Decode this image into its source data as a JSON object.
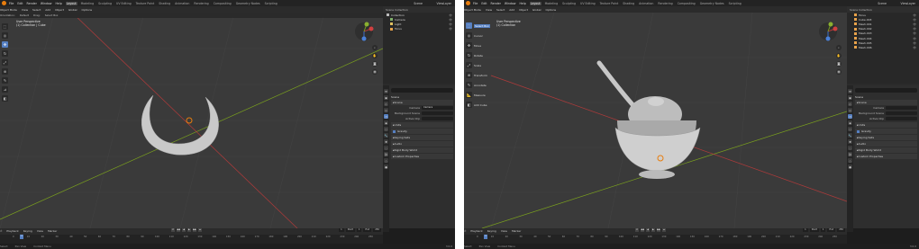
{
  "left": {
    "menu": [
      "File",
      "Edit",
      "Render",
      "Window",
      "Help"
    ],
    "workspaces": [
      "Layout",
      "Modeling",
      "Sculpting",
      "UV Editing",
      "Texture Paint",
      "Shading",
      "Animation",
      "Rendering",
      "Compositing",
      "Geometry Nodes",
      "Scripting"
    ],
    "active_workspace": "Layout",
    "scene": "Scene",
    "view_layer": "ViewLayer",
    "header": [
      "Object Mode",
      "View",
      "Select",
      "Add",
      "Object",
      "Global",
      "Options"
    ],
    "tool_settings": [
      "Orientation:",
      "Default",
      "Drag:",
      "Select Box"
    ],
    "viewport_info": {
      "line1": "User Perspective",
      "line2": "(1) Collection | Cube"
    },
    "outliner": {
      "title": "Scene Collection",
      "rows": [
        {
          "label": "Collection",
          "color": "#bbbbbb"
        },
        {
          "label": "Camera",
          "color": "#7fb06a"
        },
        {
          "label": "Light",
          "color": "#e0c060"
        },
        {
          "label": "Torus",
          "color": "#e8a24a"
        }
      ]
    },
    "props": {
      "search": "",
      "title": "Scene",
      "sections": [
        {
          "label": "Scene",
          "rows": [
            {
              "k": "Camera",
              "v": "Camera"
            },
            {
              "k": "Background Scene",
              "v": ""
            },
            {
              "k": "Active Clip",
              "v": ""
            }
          ]
        },
        {
          "label": "Units"
        },
        {
          "label": "Gravity",
          "check": true
        },
        {
          "label": "Keying Sets"
        },
        {
          "label": "Audio"
        },
        {
          "label": "Rigid Body World"
        },
        {
          "label": "Custom Properties"
        }
      ]
    },
    "timeline": {
      "items": [
        "Playback",
        "Keying",
        "View",
        "Marker"
      ],
      "current_frame": "1",
      "start_label": "Start",
      "start": "1",
      "end_label": "End",
      "end": "250",
      "ticks": [
        "0",
        "10",
        "20",
        "30",
        "40",
        "50",
        "60",
        "70",
        "80",
        "90",
        "100",
        "110",
        "120",
        "130",
        "140",
        "150",
        "160",
        "170",
        "180",
        "190",
        "200",
        "210",
        "220",
        "230",
        "240",
        "250"
      ]
    },
    "status": [
      "Select",
      "Pan View",
      "Context Menu"
    ],
    "version": "3.0.0"
  },
  "right": {
    "menu": [
      "File",
      "Edit",
      "Render",
      "Window",
      "Help"
    ],
    "workspaces": [
      "Layout",
      "Modeling",
      "Sculpting",
      "UV Editing",
      "Texture Paint",
      "Shading",
      "Animation",
      "Rendering",
      "Compositing",
      "Geometry Nodes",
      "Scripting"
    ],
    "active_workspace": "Layout",
    "scene": "Scene",
    "view_layer": "ViewLayer",
    "header": [
      "Object Mode",
      "View",
      "Select",
      "Add",
      "Object",
      "Global",
      "Options"
    ],
    "viewport_info": {
      "line1": "User Perspective",
      "line2": "(1) Collection"
    },
    "tools": [
      {
        "label": "Select Box",
        "icon": "⬚",
        "active": true
      },
      {
        "label": "Cursor",
        "icon": "◎"
      },
      {
        "label": "Move",
        "icon": "✥"
      },
      {
        "label": "Rotate",
        "icon": "↻"
      },
      {
        "label": "Scale",
        "icon": "⤢"
      },
      {
        "label": "Transform",
        "icon": "⊕"
      },
      {
        "label": "Annotate",
        "icon": "✎"
      },
      {
        "label": "Measure",
        "icon": "📐"
      },
      {
        "label": "Add Cube",
        "icon": "◧"
      }
    ],
    "outliner": {
      "title": "Scene Collection",
      "rows": [
        {
          "label": "Torus",
          "color": "#e8a24a"
        },
        {
          "label": "Cube.003",
          "color": "#e8a24a"
        },
        {
          "label": "Mesh.001",
          "color": "#e8a24a"
        },
        {
          "label": "Mesh.002",
          "color": "#e8a24a"
        },
        {
          "label": "Mesh.003",
          "color": "#e8a24a"
        },
        {
          "label": "Mesh.004",
          "color": "#e8a24a"
        },
        {
          "label": "Mesh.005",
          "color": "#e8a24a"
        },
        {
          "label": "Mesh.006",
          "color": "#e8a24a"
        }
      ]
    },
    "props": {
      "search": "",
      "title": "Scene",
      "sections": [
        {
          "label": "Scene",
          "rows": [
            {
              "k": "Camera",
              "v": ""
            },
            {
              "k": "Background Scene",
              "v": ""
            },
            {
              "k": "Active Clip",
              "v": ""
            }
          ]
        },
        {
          "label": "Units"
        },
        {
          "label": "Gravity",
          "check": true
        },
        {
          "label": "Keying Sets"
        },
        {
          "label": "Audio"
        },
        {
          "label": "Rigid Body World"
        },
        {
          "label": "Custom Properties"
        }
      ]
    },
    "timeline": {
      "items": [
        "Playback",
        "Keying",
        "View",
        "Marker"
      ],
      "current_frame": "1",
      "start_label": "Start",
      "start": "1",
      "end_label": "End",
      "end": "250",
      "ticks": [
        "0",
        "10",
        "20",
        "30",
        "40",
        "50",
        "60",
        "70",
        "80",
        "90",
        "100",
        "110",
        "120",
        "130",
        "140",
        "150",
        "160",
        "170",
        "180",
        "190",
        "200",
        "210",
        "220",
        "230",
        "240",
        "250"
      ]
    },
    "status": [
      "Select",
      "Pan View",
      "Context Menu"
    ],
    "version": "3.0.0"
  },
  "colors": {
    "accent": "#5680c2",
    "x_axis": "#b03a3a",
    "y_axis": "#7aa01e",
    "viewport": "#3a3a3a",
    "orange": "#e87d0d"
  }
}
